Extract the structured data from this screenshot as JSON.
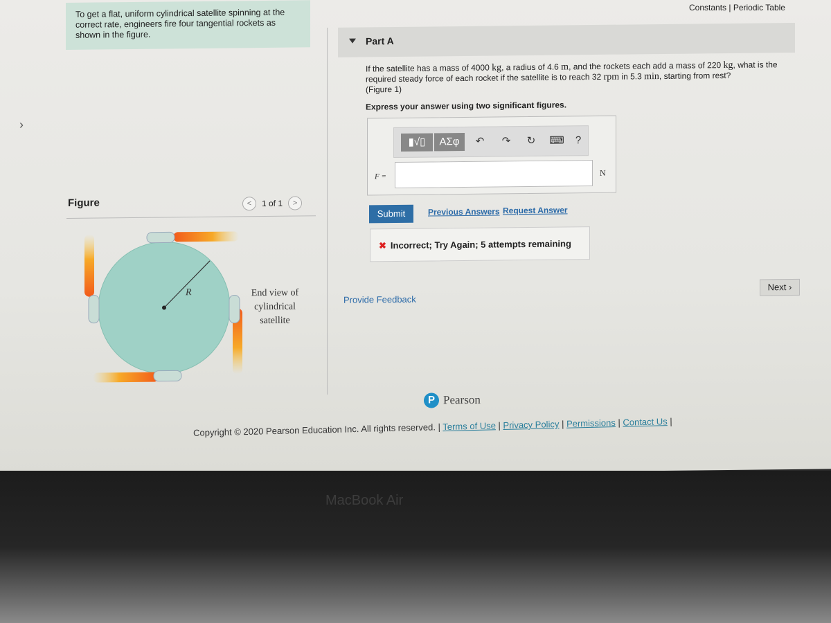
{
  "header": {
    "links": "Constants | Periodic Table"
  },
  "problem": {
    "intro": "To get a flat, uniform cylindrical satellite spinning at the correct rate, engineers fire four tangential rockets as shown in the figure."
  },
  "part": {
    "title": "Part A",
    "question_parts": [
      "If the satellite has a mass of 4000 ",
      "kg",
      ", a radius of 4.6 ",
      "m",
      ", and the rockets each add a mass of 220 ",
      "kg",
      ", what is the required steady force of each rocket if the satellite is to reach 32 ",
      "rpm",
      " in 5.3 ",
      "min",
      ", starting from rest?"
    ],
    "figure_ref": "(Figure 1)",
    "instruction": "Express your answer using two significant figures."
  },
  "answer": {
    "label": "F =",
    "unit": "N",
    "value": "",
    "toolbar": {
      "templates": "▮√▯",
      "symbols": "ΑΣφ",
      "undo": "↶",
      "redo": "↷",
      "reset": "↻",
      "keyboard": "⌨",
      "help": "?"
    }
  },
  "buttons": {
    "submit": "Submit",
    "previous": "Previous Answers",
    "request": "Request Answer",
    "next": "Next ›",
    "provide_feedback": "Provide Feedback"
  },
  "feedback": {
    "message": "Incorrect; Try Again; 5 attempts remaining",
    "icon": "x-icon",
    "color": "#dd2222"
  },
  "figure": {
    "label": "Figure",
    "pager": "1 of 1",
    "radius_label": "R",
    "caption": [
      "End view of",
      "cylindrical",
      "satellite"
    ]
  },
  "footer": {
    "brand": "Pearson",
    "copyright": "Copyright © 2020 Pearson Education Inc. All rights reserved.",
    "links": [
      "Terms of Use",
      "Privacy Policy",
      "Permissions",
      "Contact Us"
    ]
  },
  "device": {
    "label": "MacBook Air"
  },
  "colors": {
    "accent": "#2e6ea6",
    "intro_bg": "#cde2d8",
    "satellite": "#9fd1c6"
  }
}
